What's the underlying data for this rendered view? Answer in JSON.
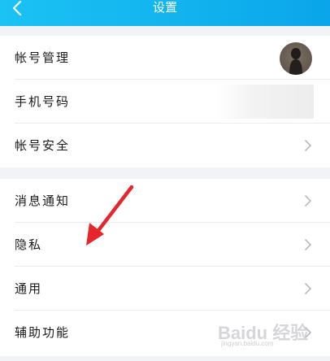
{
  "header": {
    "title": "设置",
    "back_icon": "chevron-left-icon"
  },
  "groups": [
    {
      "items": [
        {
          "label": "帐号管理",
          "trailing": "avatar"
        },
        {
          "label": "手机号码",
          "trailing": "blurred-value"
        },
        {
          "label": "帐号安全",
          "trailing": "chevron-right-icon"
        }
      ]
    },
    {
      "items": [
        {
          "label": "消息通知",
          "trailing": "chevron-right-icon"
        },
        {
          "label": "隐私",
          "trailing": "chevron-right-icon"
        },
        {
          "label": "通用",
          "trailing": "chevron-right-icon"
        },
        {
          "label": "辅助功能",
          "trailing": "chevron-right-icon"
        }
      ]
    }
  ],
  "annotation": {
    "arrow_color": "#e6262c",
    "points_to": "隐私"
  },
  "watermark": {
    "main": "Baidu 经验",
    "sub": "jingyan.baidu.com"
  },
  "colors": {
    "header_accent": "#14b6ef",
    "background": "#f2f3f7"
  }
}
